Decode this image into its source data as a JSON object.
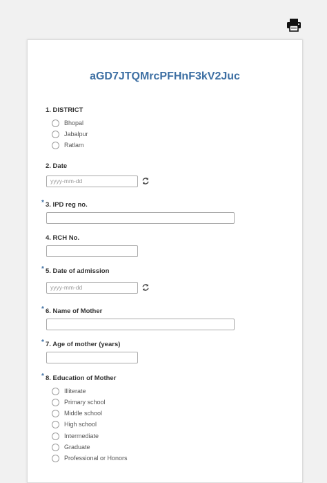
{
  "form": {
    "title": "aGD7JTQMrcPFHnF3kV2Juc"
  },
  "questions": {
    "q1": {
      "label": "1. DISTRICT",
      "options": [
        "Bhopal",
        "Jabalpur",
        "Ratlam"
      ]
    },
    "q2": {
      "label": "2. Date",
      "placeholder": "yyyy-mm-dd"
    },
    "q3": {
      "label": "3. IPD reg no.",
      "required_mark": "*"
    },
    "q4": {
      "label": "4. RCH No."
    },
    "q5": {
      "label": "5. Date of admission",
      "required_mark": "*",
      "placeholder": "yyyy-mm-dd"
    },
    "q6": {
      "label": "6. Name of Mother",
      "required_mark": "*"
    },
    "q7": {
      "label": "7. Age of mother (years)",
      "required_mark": "*"
    },
    "q8": {
      "label": "8. Education of Mother",
      "required_mark": "*",
      "options": [
        "Illiterate",
        "Primary school",
        "Middle school",
        "High school",
        "Intermediate",
        "Graduate",
        "Professional or Honors"
      ]
    }
  },
  "icons": {
    "print": "printer-icon",
    "refresh": "refresh-icon"
  },
  "colors": {
    "accent": "#3d6fa3",
    "background": "#f1f1f1"
  }
}
